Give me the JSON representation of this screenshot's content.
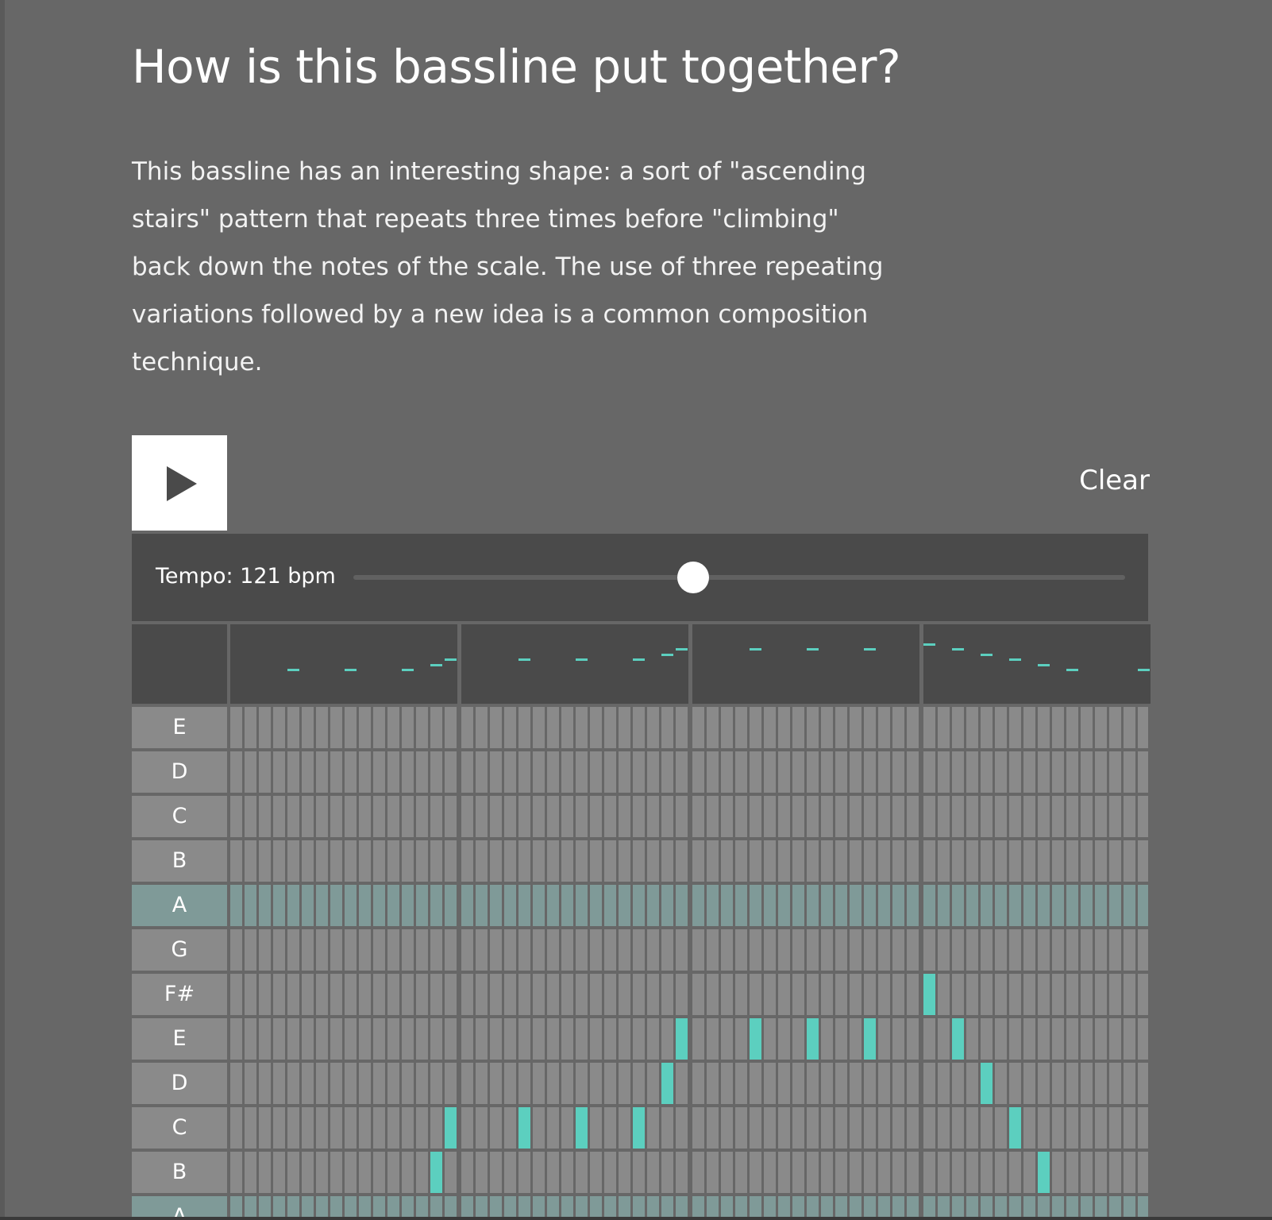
{
  "heading": "How is this bassline put together?",
  "description": "This bassline has an interesting shape: a sort of \"ascending stairs\" pattern that repeats three times before \"climbing\" back down the notes of the scale. The use of three repeating variations followed by a new idea is a common composition technique.",
  "controls": {
    "play_icon": "play-icon",
    "clear_label": "Clear",
    "tempo_label": "Tempo: 121 bpm",
    "tempo_bpm": 121,
    "tempo_slider_fraction": 0.44
  },
  "sequencer": {
    "bars": 4,
    "steps_per_bar": 16,
    "rows": [
      {
        "note": "E",
        "root": false
      },
      {
        "note": "D",
        "root": false
      },
      {
        "note": "C",
        "root": false
      },
      {
        "note": "B",
        "root": false
      },
      {
        "note": "A",
        "root": true
      },
      {
        "note": "G",
        "root": false
      },
      {
        "note": "F#",
        "root": false
      },
      {
        "note": "E",
        "root": false
      },
      {
        "note": "D",
        "root": false
      },
      {
        "note": "C",
        "root": false
      },
      {
        "note": "B",
        "root": false
      },
      {
        "note": "A",
        "root": true
      }
    ],
    "notes": [
      {
        "row": 11,
        "step": 4
      },
      {
        "row": 11,
        "step": 8
      },
      {
        "row": 11,
        "step": 12
      },
      {
        "row": 10,
        "step": 14
      },
      {
        "row": 9,
        "step": 15
      },
      {
        "row": 9,
        "step": 20
      },
      {
        "row": 9,
        "step": 24
      },
      {
        "row": 9,
        "step": 28
      },
      {
        "row": 8,
        "step": 30
      },
      {
        "row": 7,
        "step": 31
      },
      {
        "row": 7,
        "step": 36
      },
      {
        "row": 7,
        "step": 40
      },
      {
        "row": 7,
        "step": 44
      },
      {
        "row": 6,
        "step": 48
      },
      {
        "row": 7,
        "step": 50
      },
      {
        "row": 8,
        "step": 52
      },
      {
        "row": 9,
        "step": 54
      },
      {
        "row": 10,
        "step": 56
      },
      {
        "row": 11,
        "step": 58
      },
      {
        "row": 11,
        "step": 63
      }
    ],
    "accent_color": "#5ccfbf"
  }
}
